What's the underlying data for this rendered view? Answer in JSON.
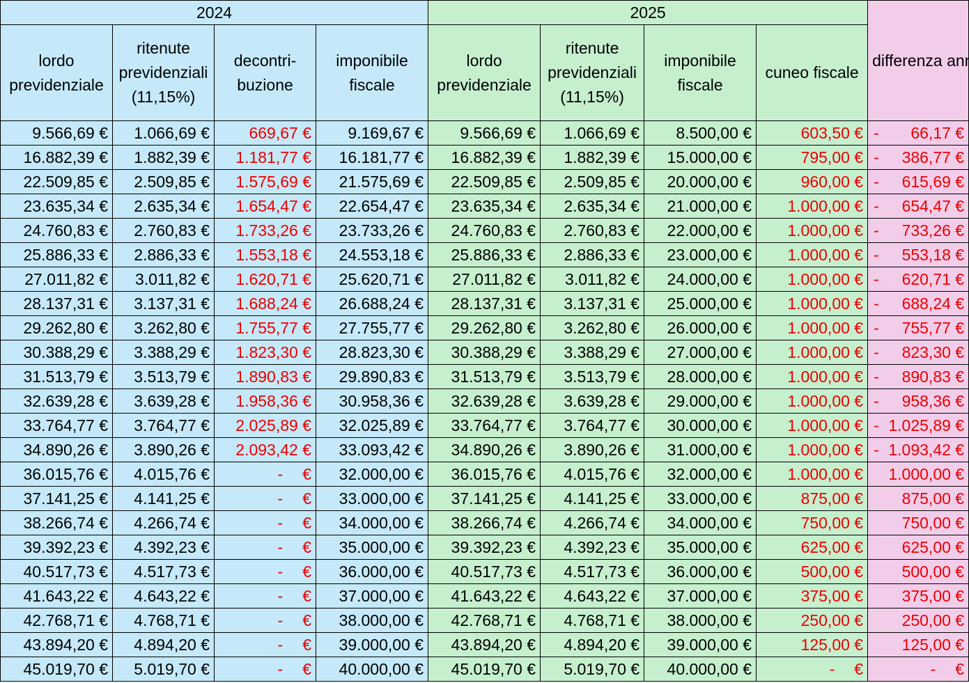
{
  "years": {
    "y2024": "2024",
    "y2025": "2025"
  },
  "columns": {
    "lordo_2024": "lordo previdenziale",
    "ritenute_2024": "ritenute previdenziali (11,15%)",
    "decontribuzione": "decontri-buzione",
    "imponibile_2024": "imponibile fiscale",
    "lordo_2025": "lordo previdenziale",
    "ritenute_2025": "ritenute previdenziali (11,15%)",
    "imponibile_2025": "imponibile fiscale",
    "cuneo": "cuneo fiscale",
    "differenza": "differenza annuale"
  },
  "colors": {
    "blue": "#c5e9f8",
    "green": "#c6efce",
    "pink": "#f2cdea",
    "red": "#ea0000"
  },
  "currency": "€",
  "dash": "-",
  "rows": [
    [
      "9.566,69 €",
      "1.066,69 €",
      "669,67 €",
      "9.169,67 €",
      "9.566,69 €",
      "1.066,69 €",
      "8.500,00 €",
      "603,50 €",
      "66,17 €"
    ],
    [
      "16.882,39 €",
      "1.882,39 €",
      "1.181,77 €",
      "16.181,77 €",
      "16.882,39 €",
      "1.882,39 €",
      "15.000,00 €",
      "795,00 €",
      "386,77 €"
    ],
    [
      "22.509,85 €",
      "2.509,85 €",
      "1.575,69 €",
      "21.575,69 €",
      "22.509,85 €",
      "2.509,85 €",
      "20.000,00 €",
      "960,00 €",
      "615,69 €"
    ],
    [
      "23.635,34 €",
      "2.635,34 €",
      "1.654,47 €",
      "22.654,47 €",
      "23.635,34 €",
      "2.635,34 €",
      "21.000,00 €",
      "1.000,00 €",
      "654,47 €"
    ],
    [
      "24.760,83 €",
      "2.760,83 €",
      "1.733,26 €",
      "23.733,26 €",
      "24.760,83 €",
      "2.760,83 €",
      "22.000,00 €",
      "1.000,00 €",
      "733,26 €"
    ],
    [
      "25.886,33 €",
      "2.886,33 €",
      "1.553,18 €",
      "24.553,18 €",
      "25.886,33 €",
      "2.886,33 €",
      "23.000,00 €",
      "1.000,00 €",
      "553,18 €"
    ],
    [
      "27.011,82 €",
      "3.011,82 €",
      "1.620,71 €",
      "25.620,71 €",
      "27.011,82 €",
      "3.011,82 €",
      "24.000,00 €",
      "1.000,00 €",
      "620,71 €"
    ],
    [
      "28.137,31 €",
      "3.137,31 €",
      "1.688,24 €",
      "26.688,24 €",
      "28.137,31 €",
      "3.137,31 €",
      "25.000,00 €",
      "1.000,00 €",
      "688,24 €"
    ],
    [
      "29.262,80 €",
      "3.262,80 €",
      "1.755,77 €",
      "27.755,77 €",
      "29.262,80 €",
      "3.262,80 €",
      "26.000,00 €",
      "1.000,00 €",
      "755,77 €"
    ],
    [
      "30.388,29 €",
      "3.388,29 €",
      "1.823,30 €",
      "28.823,30 €",
      "30.388,29 €",
      "3.388,29 €",
      "27.000,00 €",
      "1.000,00 €",
      "823,30 €"
    ],
    [
      "31.513,79 €",
      "3.513,79 €",
      "1.890,83 €",
      "29.890,83 €",
      "31.513,79 €",
      "3.513,79 €",
      "28.000,00 €",
      "1.000,00 €",
      "890,83 €"
    ],
    [
      "32.639,28 €",
      "3.639,28 €",
      "1.958,36 €",
      "30.958,36 €",
      "32.639,28 €",
      "3.639,28 €",
      "29.000,00 €",
      "1.000,00 €",
      "958,36 €"
    ],
    [
      "33.764,77 €",
      "3.764,77 €",
      "2.025,89 €",
      "32.025,89 €",
      "33.764,77 €",
      "3.764,77 €",
      "30.000,00 €",
      "1.000,00 €",
      "1.025,89 €"
    ],
    [
      "34.890,26 €",
      "3.890,26 €",
      "2.093,42 €",
      "33.093,42 €",
      "34.890,26 €",
      "3.890,26 €",
      "31.000,00 €",
      "1.000,00 €",
      "1.093,42 €"
    ],
    [
      "36.015,76 €",
      "4.015,76 €",
      "",
      "32.000,00 €",
      "36.015,76 €",
      "4.015,76 €",
      "32.000,00 €",
      "1.000,00 €",
      "1.000,00 €"
    ],
    [
      "37.141,25 €",
      "4.141,25 €",
      "",
      "33.000,00 €",
      "37.141,25 €",
      "4.141,25 €",
      "33.000,00 €",
      "875,00 €",
      "875,00 €"
    ],
    [
      "38.266,74 €",
      "4.266,74 €",
      "",
      "34.000,00 €",
      "38.266,74 €",
      "4.266,74 €",
      "34.000,00 €",
      "750,00 €",
      "750,00 €"
    ],
    [
      "39.392,23 €",
      "4.392,23 €",
      "",
      "35.000,00 €",
      "39.392,23 €",
      "4.392,23 €",
      "35.000,00 €",
      "625,00 €",
      "625,00 €"
    ],
    [
      "40.517,73 €",
      "4.517,73 €",
      "",
      "36.000,00 €",
      "40.517,73 €",
      "4.517,73 €",
      "36.000,00 €",
      "500,00 €",
      "500,00 €"
    ],
    [
      "41.643,22 €",
      "4.643,22 €",
      "",
      "37.000,00 €",
      "41.643,22 €",
      "4.643,22 €",
      "37.000,00 €",
      "375,00 €",
      "375,00 €"
    ],
    [
      "42.768,71 €",
      "4.768,71 €",
      "",
      "38.000,00 €",
      "42.768,71 €",
      "4.768,71 €",
      "38.000,00 €",
      "250,00 €",
      "250,00 €"
    ],
    [
      "43.894,20 €",
      "4.894,20 €",
      "",
      "39.000,00 €",
      "43.894,20 €",
      "4.894,20 €",
      "39.000,00 €",
      "125,00 €",
      "125,00 €"
    ],
    [
      "45.019,70 €",
      "5.019,70 €",
      "",
      "40.000,00 €",
      "45.019,70 €",
      "5.019,70 €",
      "40.000,00 €",
      "",
      ""
    ]
  ],
  "negative_differences": [
    0,
    1,
    2,
    3,
    4,
    5,
    6,
    7,
    8,
    9,
    10,
    11,
    12,
    13
  ]
}
